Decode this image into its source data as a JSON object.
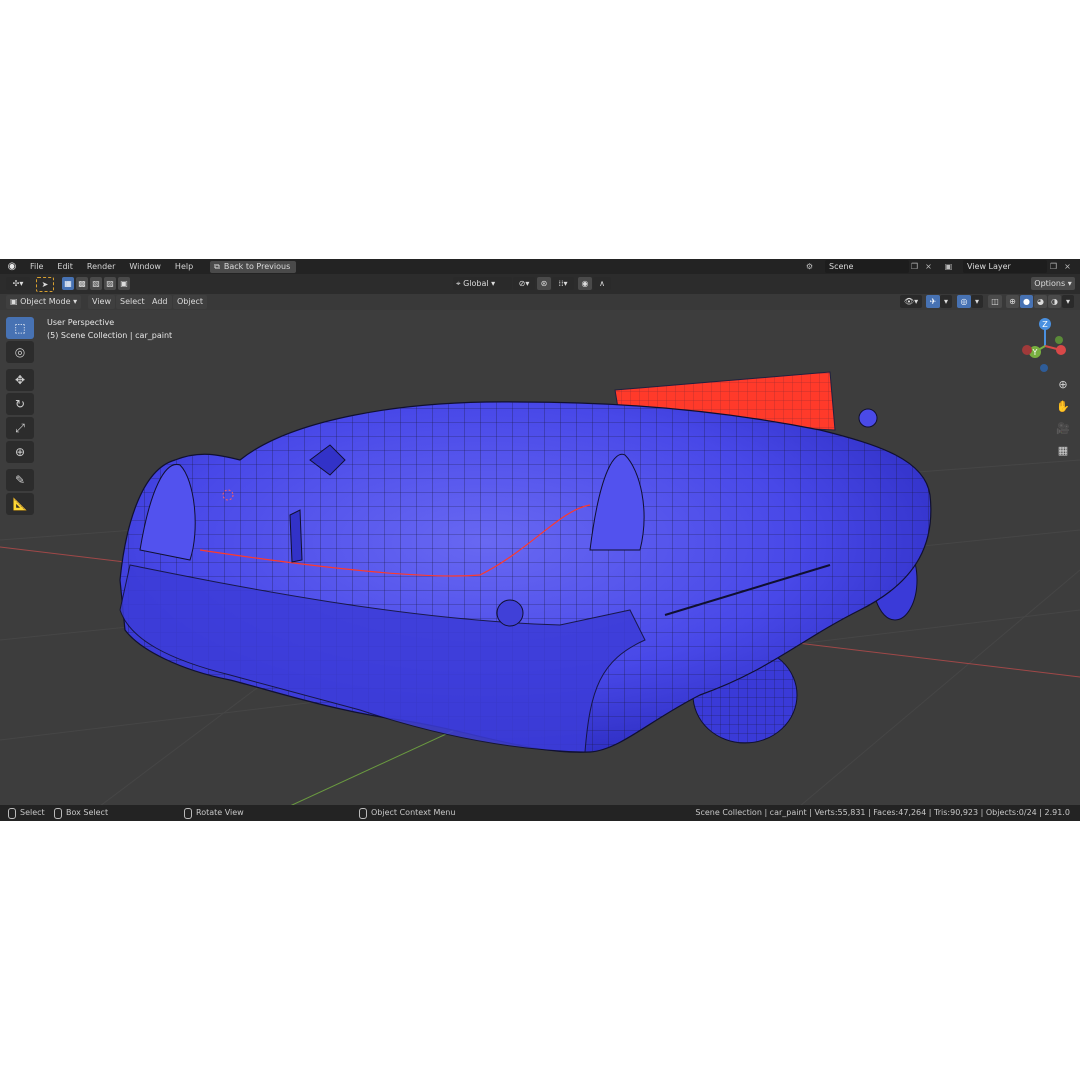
{
  "menu": {
    "items": [
      "File",
      "Edit",
      "Render",
      "Window",
      "Help"
    ],
    "back_button": "Back to Previous",
    "scene_field": "Scene",
    "view_layer_field": "View Layer"
  },
  "tool_settings": {
    "orientation": "Global",
    "options_label": "Options"
  },
  "header": {
    "mode": "Object Mode",
    "menus": [
      "View",
      "Select",
      "Add",
      "Object"
    ]
  },
  "viewport": {
    "perspective_label": "User Perspective",
    "collection_label": "(5) Scene Collection | car_paint",
    "gizmo_axes": [
      "Z",
      "Y",
      "X"
    ],
    "colors": {
      "body": "#4545e8",
      "glass": "#ff3a2a",
      "wire": "#1a1a40",
      "x_axis": "#b84848",
      "y_axis": "#78a040"
    }
  },
  "status": {
    "select": "Select",
    "box_select": "Box Select",
    "rotate_view": "Rotate View",
    "context_menu": "Object Context Menu",
    "stats": "Scene Collection | car_paint | Verts:55,831 | Faces:47,264 | Tris:90,923 | Objects:0/24 | 2.91.0"
  }
}
